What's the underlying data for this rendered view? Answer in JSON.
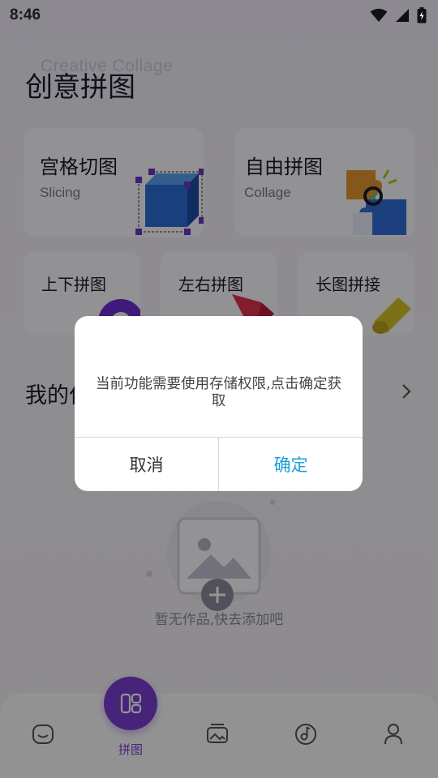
{
  "status_bar": {
    "time": "8:46"
  },
  "header": {
    "title": "创意拼图",
    "bg_subtitle": "Creative Collage"
  },
  "cards": {
    "slicing": {
      "title": "宫格切图",
      "sub": "Slicing"
    },
    "collage": {
      "title": "自由拼图",
      "sub": "Collage"
    },
    "vertical": {
      "title": "上下拼图"
    },
    "horizontal": {
      "title": "左右拼图"
    },
    "long": {
      "title": "长图拼接"
    }
  },
  "my_works": {
    "title": "我的作品",
    "empty_text": "暂无作品,快去添加吧"
  },
  "bottom_nav": {
    "center_label": "拼图"
  },
  "dialog": {
    "message": "当前功能需要使用存储权限,点击确定获取",
    "cancel_label": "取消",
    "confirm_label": "确定"
  },
  "colors": {
    "accent": "#7a3fd0",
    "confirm": "#1a9ed8"
  }
}
